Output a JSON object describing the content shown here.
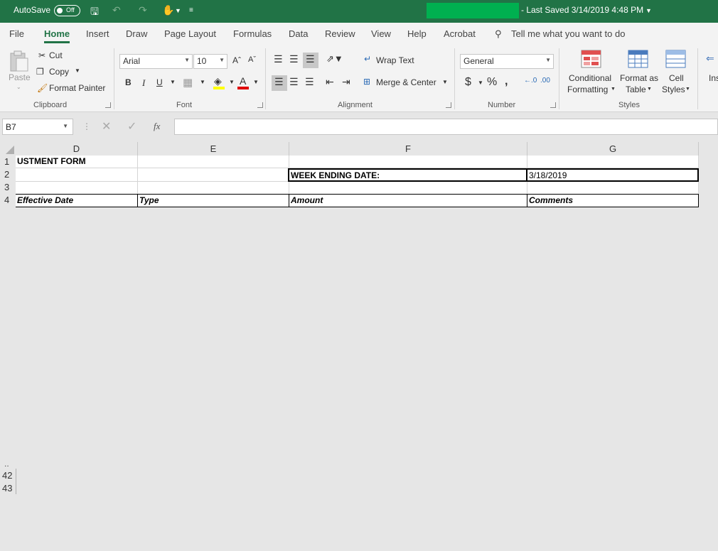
{
  "titlebar": {
    "autosave_label": "AutoSave",
    "autosave_state": "Off",
    "last_saved": "- Last Saved 3/14/2019 4:48 PM",
    "redaction_color": "#00b050",
    "accent": "#217346"
  },
  "tabs": [
    "File",
    "Home",
    "Insert",
    "Draw",
    "Page Layout",
    "Formulas",
    "Data",
    "Review",
    "View",
    "Help",
    "Acrobat"
  ],
  "active_tab": "Home",
  "tell_me": "Tell me what you want to do",
  "ribbon": {
    "clipboard": {
      "paste": "Paste",
      "cut": "Cut",
      "copy": "Copy",
      "format_painter": "Format Painter",
      "label": "Clipboard"
    },
    "font": {
      "name": "Arial",
      "size": "10",
      "bold": "B",
      "italic": "I",
      "underline": "U",
      "label": "Font"
    },
    "alignment": {
      "wrap": "Wrap Text",
      "merge": "Merge & Center",
      "label": "Alignment"
    },
    "number": {
      "format": "General",
      "currency": "$",
      "percent": "%",
      "comma": " 9",
      "label": "Number"
    },
    "styles": {
      "conditional_1": "Conditional",
      "conditional_2": "Formatting",
      "format_table_1": "Format as",
      "format_table_2": "Table",
      "cell_styles_1": "Cell",
      "cell_styles_2": "Styles",
      "label": "Styles"
    },
    "insert_partial": "Ins"
  },
  "formula_bar": {
    "name_box": "B7",
    "fx": "fx",
    "value": ""
  },
  "columns": [
    "D",
    "E",
    "F",
    "G"
  ],
  "rows": [
    "1",
    "2",
    "3",
    "4"
  ],
  "bottom_rows": [
    "42",
    "43"
  ],
  "cells": {
    "D1": "USTMENT FORM",
    "F2": "WEEK ENDING DATE:",
    "G2": "3/18/2019",
    "D4": "Effective Date",
    "E4": "Type",
    "F4": "Amount",
    "G4": "Comments"
  }
}
